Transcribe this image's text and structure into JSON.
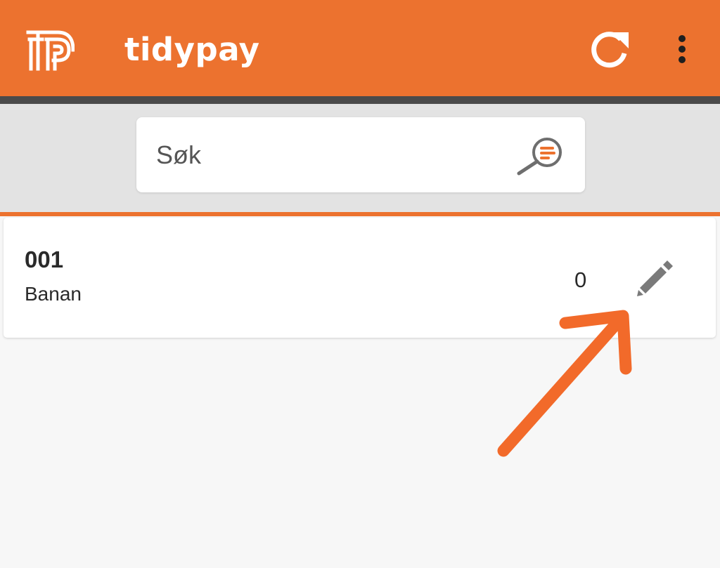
{
  "app_bar": {
    "title": "tidypay",
    "logo_icon": "tidypay-logo",
    "refresh_icon": "refresh-icon",
    "more_icon": "more-vertical-icon",
    "background": "#ec722f"
  },
  "search": {
    "placeholder": "Søk",
    "value": "",
    "icon": "search-icon"
  },
  "items": [
    {
      "code": "001",
      "name": "Banan",
      "quantity": "0",
      "edit_icon": "pencil-icon"
    }
  ],
  "colors": {
    "accent": "#ec722f",
    "annotation_arrow": "#f26a2a",
    "divider": "#4a4a4a",
    "search_band": "#e3e3e3",
    "page_background": "#f7f7f7",
    "icon_gray": "#7a7a7a"
  }
}
